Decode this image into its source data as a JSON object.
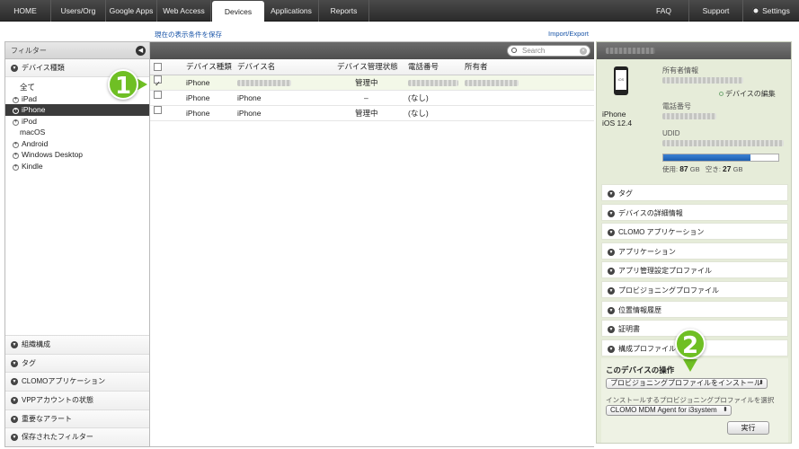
{
  "nav": {
    "tabs": [
      "HOME",
      "Users/Org",
      "Google Apps",
      "Web Access",
      "Devices",
      "Applications",
      "Reports"
    ],
    "active": "Devices",
    "right": [
      "FAQ",
      "Support",
      "Settings"
    ]
  },
  "toolbar": {
    "save_view": "現在の表示条件を保存",
    "import_export": "Import/Export"
  },
  "filter": {
    "title": "フィルター",
    "device_type_header": "デバイス種類",
    "items": [
      "全て",
      "iPad",
      "iPhone",
      "iPod",
      "macOS",
      "Android",
      "Windows Desktop",
      "Kindle"
    ],
    "selected": "iPhone",
    "bottom_sections": [
      "組織構成",
      "タグ",
      "CLOMOアプリケーション",
      "VPPアカウントの状態",
      "重要なアラート",
      "保存されたフィルター"
    ]
  },
  "search": {
    "placeholder": "Search"
  },
  "table": {
    "headers": [
      "デバイス種類",
      "デバイス名",
      "デバイス管理状態",
      "電話番号",
      "所有者"
    ],
    "rows": [
      {
        "type": "iPhone",
        "name": "",
        "status": "管理中",
        "phone": "",
        "owner": "",
        "checked": true
      },
      {
        "type": "iPhone",
        "name": "iPhone",
        "status": "–",
        "phone": "(なし)",
        "owner": "",
        "checked": false
      },
      {
        "type": "iPhone",
        "name": "iPhone",
        "status": "管理中",
        "phone": "(なし)",
        "owner": "",
        "checked": false
      }
    ]
  },
  "detail": {
    "device_model": "iPhone",
    "os_version": "iOS 12.4",
    "phone_screen_text": "iOS",
    "owner_label": "所有者情報",
    "edit_device": "デバイスの編集",
    "phone_label": "電話番号",
    "udid_label": "UDID",
    "used_label": "使用:",
    "used_value": "87",
    "free_label": "空き:",
    "free_value": "27",
    "unit": "GB",
    "usage_fraction": 0.76,
    "sections": [
      "タグ",
      "デバイスの詳細情報",
      "CLOMO アプリケーション",
      "アプリケーション",
      "アプリ管理設定プロファイル",
      "プロビジョニングプロファイル",
      "位置情報履歴",
      "証明書",
      "構成プロファイル"
    ],
    "ops_title": "このデバイスの操作",
    "ops_select": "プロビジョニングプロファイルをインストール",
    "ops_hint": "インストールするプロビジョニングプロファイルを選択",
    "profile_select": "CLOMO MDM Agent for i3system",
    "exec_label": "実行"
  },
  "callouts": [
    "1",
    "2"
  ],
  "colors": {
    "callout": "#6fbf24",
    "link": "#1a55a8",
    "selected_row": "#3b3b3b",
    "usage_bar": "#1c5db0"
  }
}
